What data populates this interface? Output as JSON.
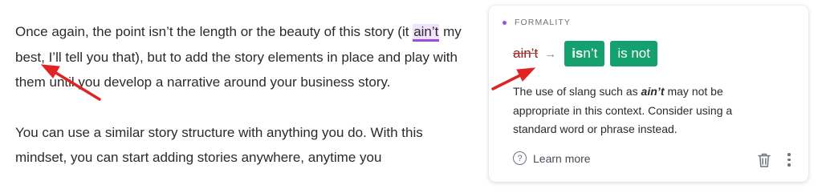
{
  "doc": {
    "p1": {
      "before": "Once again, the point isn’t the length or the beauty of this story (it ",
      "flagged": "ain’t",
      "after": " my best, I’ll tell you that), but to add the story elements in place and play with them until you develop a narrative around your business story."
    },
    "p2": "You can use a similar story structure with anything you do. With this mindset, you can start adding stories anywhere, anytime you"
  },
  "card": {
    "category": "FORMALITY",
    "original": "ain’t",
    "suggestions": [
      {
        "bold": "is",
        "rest": "n’t"
      },
      {
        "bold": "",
        "rest": "is not"
      }
    ],
    "desc_before": "The use of slang such as ",
    "desc_term": "ain’t",
    "desc_after": " may not be appropriate in this context. Consider using a standard word or phrase instead.",
    "learn_more": "Learn more"
  },
  "colors": {
    "accent": "#9d4dde",
    "suggestion": "#15a06f",
    "arrow": "#e02424"
  },
  "icons": [
    "dot-icon",
    "arrow-right-icon",
    "help-circle-icon",
    "trash-icon",
    "more-vertical-icon"
  ]
}
